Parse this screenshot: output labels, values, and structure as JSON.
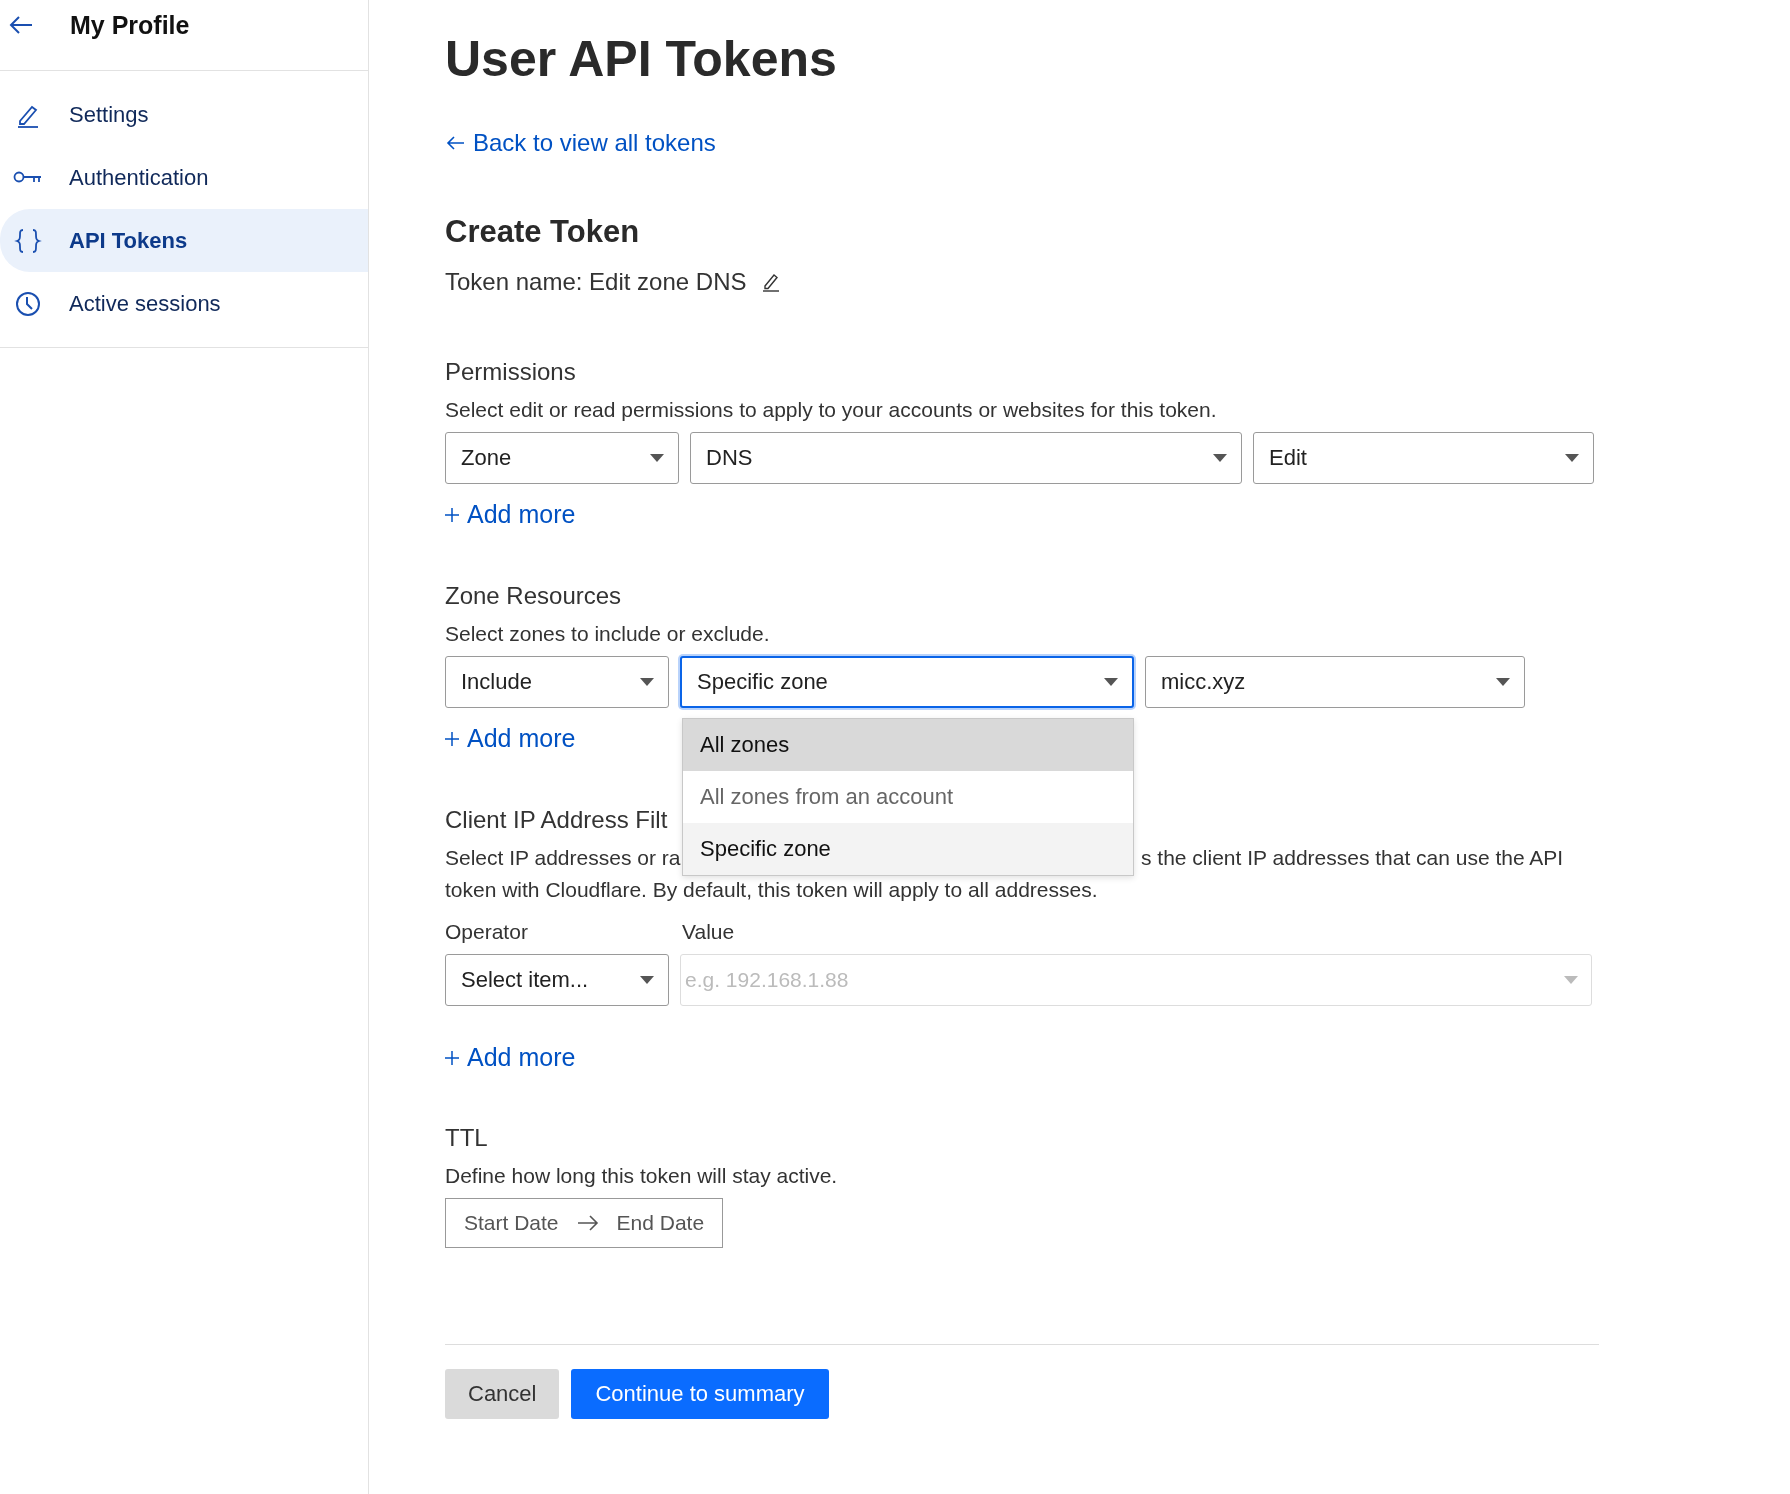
{
  "sidebar": {
    "title": "My Profile",
    "items": [
      {
        "label": "Settings",
        "selected": false
      },
      {
        "label": "Authentication",
        "selected": false
      },
      {
        "label": "API Tokens",
        "selected": true
      },
      {
        "label": "Active sessions",
        "selected": false
      }
    ]
  },
  "page_title": "User API Tokens",
  "back_link": "Back to view all tokens",
  "section_title": "Create Token",
  "token_name": "Token name: Edit zone DNS",
  "permissions": {
    "title": "Permissions",
    "description": "Select edit or read permissions to apply to your accounts or websites for this token.",
    "selects": [
      {
        "value": "Zone",
        "focused": false
      },
      {
        "value": "DNS",
        "focused": false
      },
      {
        "value": "Edit",
        "focused": false
      }
    ],
    "add_more": "Add more"
  },
  "zone_resources": {
    "title": "Zone Resources",
    "description": "Select zones to include or exclude.",
    "selects": [
      {
        "value": "Include",
        "focused": false
      },
      {
        "value": "Specific zone",
        "focused": true
      },
      {
        "value": "micc.xyz",
        "focused": false
      }
    ],
    "menu": [
      {
        "label": "All zones",
        "hovered": true,
        "disabled": false,
        "selected": false
      },
      {
        "label": "All zones from an account",
        "hovered": false,
        "disabled": true,
        "selected": false
      },
      {
        "label": "Specific zone",
        "hovered": false,
        "disabled": false,
        "selected": true
      }
    ],
    "add_more": "Add more"
  },
  "client_ip": {
    "title": "Client IP Address Filt",
    "description_left": "Select IP addresses or ra",
    "description_right": "s the client IP addresses that can use the API",
    "description_line2": "token with Cloudflare. By default, this token will apply to all addresses.",
    "operator_label": "Operator",
    "value_label": "Value",
    "operator": {
      "value": "Select item..."
    },
    "value_field": {
      "placeholder": "e.g. 192.168.1.88",
      "disabled": true
    },
    "add_more": "Add more"
  },
  "ttl": {
    "title": "TTL",
    "description": "Define how long this token will stay active.",
    "start": "Start Date",
    "end": "End Date"
  },
  "buttons": {
    "cancel": "Cancel",
    "continue": "Continue to summary"
  }
}
